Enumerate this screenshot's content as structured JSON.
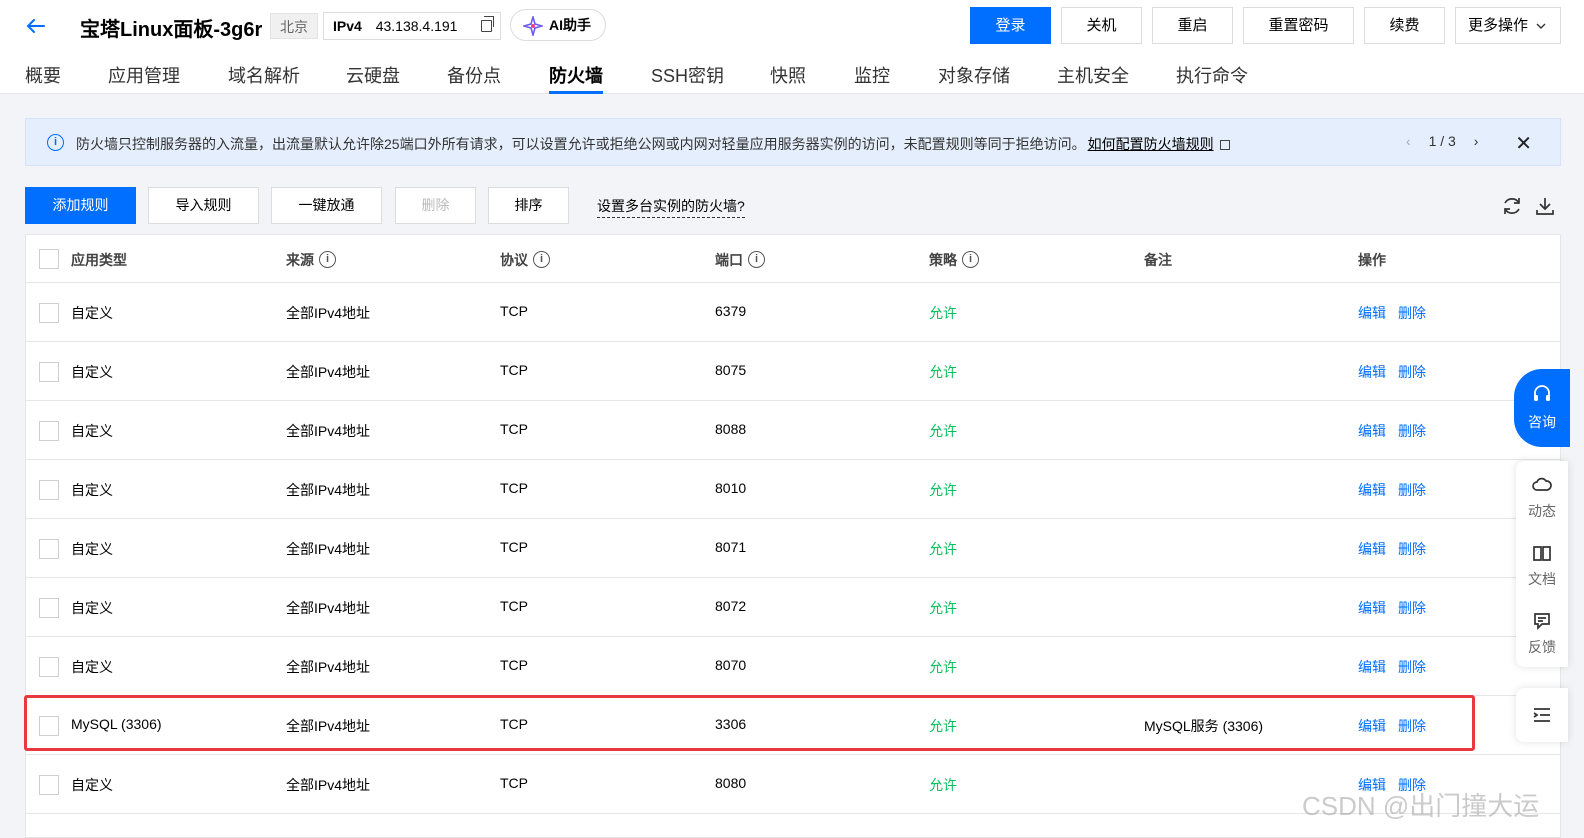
{
  "header": {
    "title": "宝塔Linux面板-3g6r",
    "region": "北京",
    "ip_label": "IPv4",
    "ip_value": "43.138.4.191",
    "ai_label": "AI助手",
    "buttons": {
      "login": "登录",
      "shutdown": "关机",
      "restart": "重启",
      "reset_password": "重置密码",
      "renew": "续费",
      "more": "更多操作"
    }
  },
  "tabs": [
    "概要",
    "应用管理",
    "域名解析",
    "云硬盘",
    "备份点",
    "防火墙",
    "SSH密钥",
    "快照",
    "监控",
    "对象存储",
    "主机安全",
    "执行命令"
  ],
  "active_tab": "防火墙",
  "notice": {
    "text": "防火墙只控制服务器的入流量，出流量默认允许除25端口外所有请求，可以设置允许或拒绝公网或内网对轻量应用服务器实例的访问，未配置规则等同于拒绝访问。",
    "link": "如何配置防火墙规则",
    "pager": "1 / 3"
  },
  "toolbar": {
    "add": "添加规则",
    "import": "导入规则",
    "open_all": "一键放通",
    "delete": "删除",
    "sort": "排序",
    "multi": "设置多台实例的防火墙?"
  },
  "columns": {
    "type": "应用类型",
    "source": "来源",
    "protocol": "协议",
    "port": "端口",
    "policy": "策略",
    "remark": "备注",
    "ops": "操作"
  },
  "op_labels": {
    "edit": "编辑",
    "delete": "删除"
  },
  "rows": [
    {
      "type": "自定义",
      "source": "全部IPv4地址",
      "protocol": "TCP",
      "port": "6379",
      "policy": "允许",
      "remark": ""
    },
    {
      "type": "自定义",
      "source": "全部IPv4地址",
      "protocol": "TCP",
      "port": "8075",
      "policy": "允许",
      "remark": ""
    },
    {
      "type": "自定义",
      "source": "全部IPv4地址",
      "protocol": "TCP",
      "port": "8088",
      "policy": "允许",
      "remark": ""
    },
    {
      "type": "自定义",
      "source": "全部IPv4地址",
      "protocol": "TCP",
      "port": "8010",
      "policy": "允许",
      "remark": ""
    },
    {
      "type": "自定义",
      "source": "全部IPv4地址",
      "protocol": "TCP",
      "port": "8071",
      "policy": "允许",
      "remark": ""
    },
    {
      "type": "自定义",
      "source": "全部IPv4地址",
      "protocol": "TCP",
      "port": "8072",
      "policy": "允许",
      "remark": ""
    },
    {
      "type": "自定义",
      "source": "全部IPv4地址",
      "protocol": "TCP",
      "port": "8070",
      "policy": "允许",
      "remark": ""
    },
    {
      "type": "MySQL (3306)",
      "source": "全部IPv4地址",
      "protocol": "TCP",
      "port": "3306",
      "policy": "允许",
      "remark": "MySQL服务 (3306)"
    },
    {
      "type": "自定义",
      "source": "全部IPv4地址",
      "protocol": "TCP",
      "port": "8080",
      "policy": "允许",
      "remark": ""
    }
  ],
  "side": {
    "consult": "咨询",
    "activity": "动态",
    "docs": "文档",
    "feedback": "反馈"
  },
  "watermark": "CSDN @出门撞大运",
  "colors": {
    "primary": "#006eff",
    "allow": "#0abf5b",
    "highlight": "#e9393f"
  }
}
